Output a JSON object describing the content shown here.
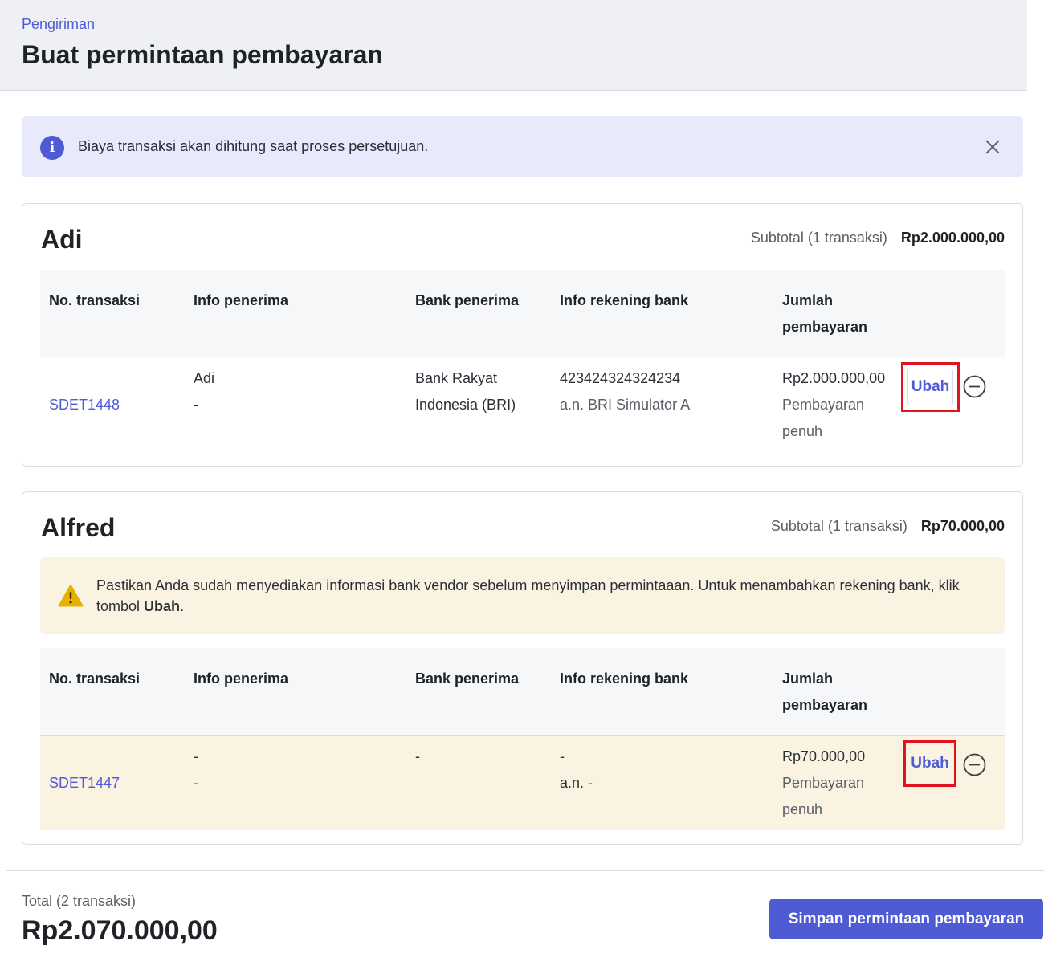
{
  "header": {
    "breadcrumb": "Pengiriman",
    "title": "Buat permintaan pembayaran"
  },
  "info_banner": {
    "icon": "info-icon",
    "icon_glyph": "i",
    "text": "Biaya transaksi akan dihitung saat proses persetujuan."
  },
  "table_headers": [
    "No. transaksi",
    "Info penerima",
    "Bank penerima",
    "Info rekening bank",
    "Jumlah",
    "pembayaran"
  ],
  "groups": [
    {
      "name": "Adi",
      "subtotal_label": "Subtotal (1 transaksi)",
      "subtotal_value": "Rp2.000.000,00",
      "row": {
        "transaction_no": "SDET1448",
        "recipient_name": "Adi",
        "recipient_extra": "-",
        "bank_line1": "Bank Rakyat",
        "bank_line2": "Indonesia (BRI)",
        "account_no": "423424324324234",
        "account_name": "a.n. BRI Simulator A",
        "amount": "Rp2.000.000,00",
        "payment_type_line1": "Pembayaran",
        "payment_type_line2": "penuh",
        "edit_label": "Ubah"
      }
    },
    {
      "name": "Alfred",
      "subtotal_label": "Subtotal (1 transaksi)",
      "subtotal_value": "Rp70.000,00",
      "warning": {
        "text_before": "Pastikan Anda sudah menyediakan informasi bank vendor sebelum menyimpan permintaaan. Untuk menambahkan rekening bank, klik tombol ",
        "bold": "Ubah",
        "text_after": "."
      },
      "row": {
        "transaction_no": "SDET1447",
        "recipient_name": "-",
        "recipient_extra": "-",
        "bank_line1": "-",
        "account_no": "-",
        "account_name": "a.n. -",
        "amount": "Rp70.000,00",
        "payment_type_line1": "Pembayaran",
        "payment_type_line2": "penuh",
        "edit_label": "Ubah"
      }
    }
  ],
  "footer": {
    "total_label": "Total (2 transaksi)",
    "total_value": "Rp2.070.000,00",
    "submit_label": "Simpan permintaan pembayaran"
  },
  "colors": {
    "accent": "#4f5bd5",
    "highlight": "#e0141e",
    "warning_bg": "#fbf3e1",
    "warning_icon": "#e5b000",
    "info_bg": "#e8eafb"
  }
}
